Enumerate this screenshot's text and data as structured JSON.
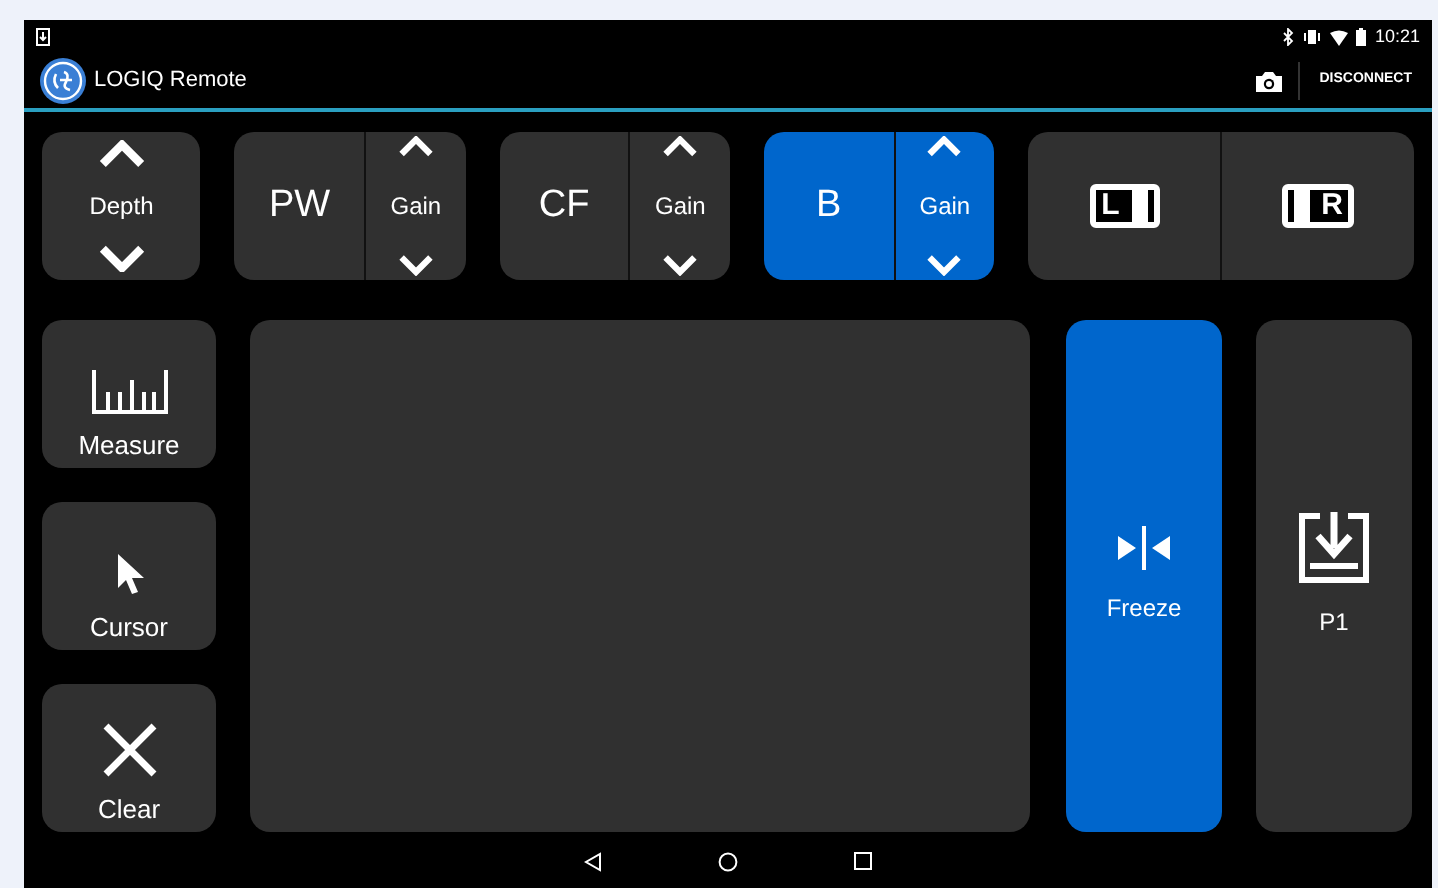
{
  "status_bar": {
    "time": "10:21"
  },
  "app_bar": {
    "title": "LOGIQ Remote",
    "action": "DISCONNECT"
  },
  "depth": {
    "label": "Depth"
  },
  "modes": [
    {
      "label": "PW",
      "gain": "Gain",
      "selected": false
    },
    {
      "label": "CF",
      "gain": "Gain",
      "selected": false
    },
    {
      "label": "B",
      "gain": "Gain",
      "selected": true
    }
  ],
  "layout_buttons": [
    {
      "letter": "L",
      "kind": "left"
    },
    {
      "letter": "R",
      "kind": "right"
    }
  ],
  "tools": [
    {
      "label": "Measure",
      "kind": "ruler"
    },
    {
      "label": "Cursor",
      "kind": "pointer"
    },
    {
      "label": "Clear",
      "kind": "cross"
    }
  ],
  "freeze": {
    "label": "Freeze",
    "active": true
  },
  "print": {
    "label": "P1"
  }
}
